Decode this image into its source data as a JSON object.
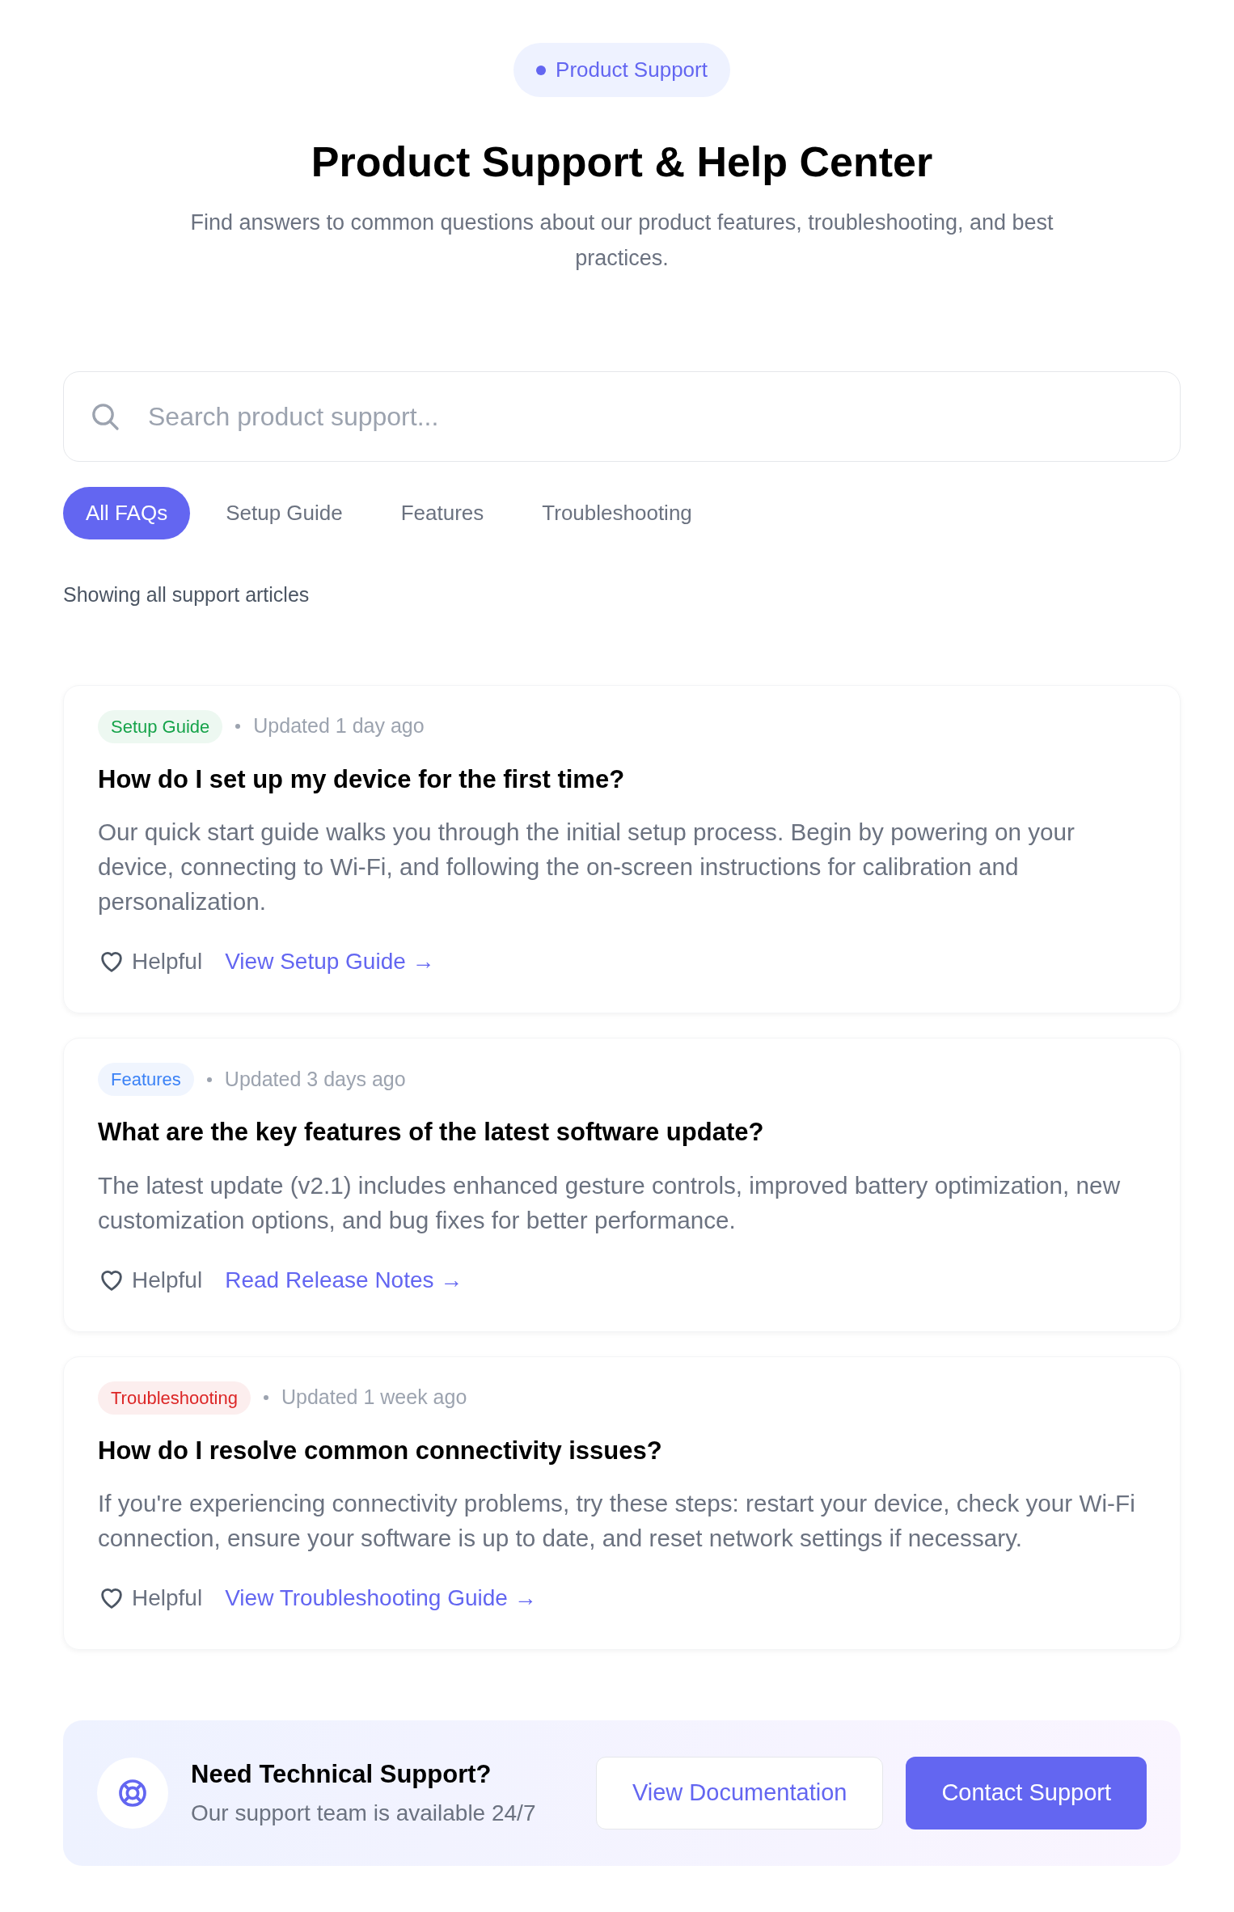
{
  "badge": "Product Support",
  "title": "Product Support & Help Center",
  "subtitle": "Find answers to common questions about our product features, troubleshooting, and best practices.",
  "search": {
    "placeholder": "Search product support..."
  },
  "tabs": [
    {
      "label": "All FAQs",
      "selected": true
    },
    {
      "label": "Setup Guide",
      "selected": false
    },
    {
      "label": "Features",
      "selected": false
    },
    {
      "label": "Troubleshooting",
      "selected": false
    }
  ],
  "result_note": "Showing all support articles",
  "articles": [
    {
      "tag": "Setup Guide",
      "color": "#16a34a",
      "updated": "Updated 1 day ago",
      "question": "How do I set up my device for the first time?",
      "answer": "Our quick start guide walks you through the initial setup process. Begin by powering on your device, connecting to Wi-Fi, and following the on-screen instructions for calibration and personalization.",
      "helpful": "Helpful",
      "link": "View Setup Guide →"
    },
    {
      "tag": "Features",
      "color": "#3b82f6",
      "updated": "Updated 3 days ago",
      "question": "What are the key features of the latest software update?",
      "answer": "The latest update (v2.1) includes enhanced gesture controls, improved battery optimization, new customization options, and bug fixes for better performance.",
      "helpful": "Helpful",
      "link": "Read Release Notes →"
    },
    {
      "tag": "Troubleshooting",
      "color": "#dc2626",
      "updated": "Updated 1 week ago",
      "question": "How do I resolve common connectivity issues?",
      "answer": "If you're experiencing connectivity problems, try these steps: restart your device, check your Wi-Fi connection, ensure your software is up to date, and reset network settings if necessary.",
      "helpful": "Helpful",
      "link": "View Troubleshooting Guide →"
    }
  ],
  "support_banner": {
    "title": "Need Technical Support?",
    "text": "Our support team is available 24/7",
    "buttons": [
      "View Documentation",
      "Contact Support"
    ]
  }
}
